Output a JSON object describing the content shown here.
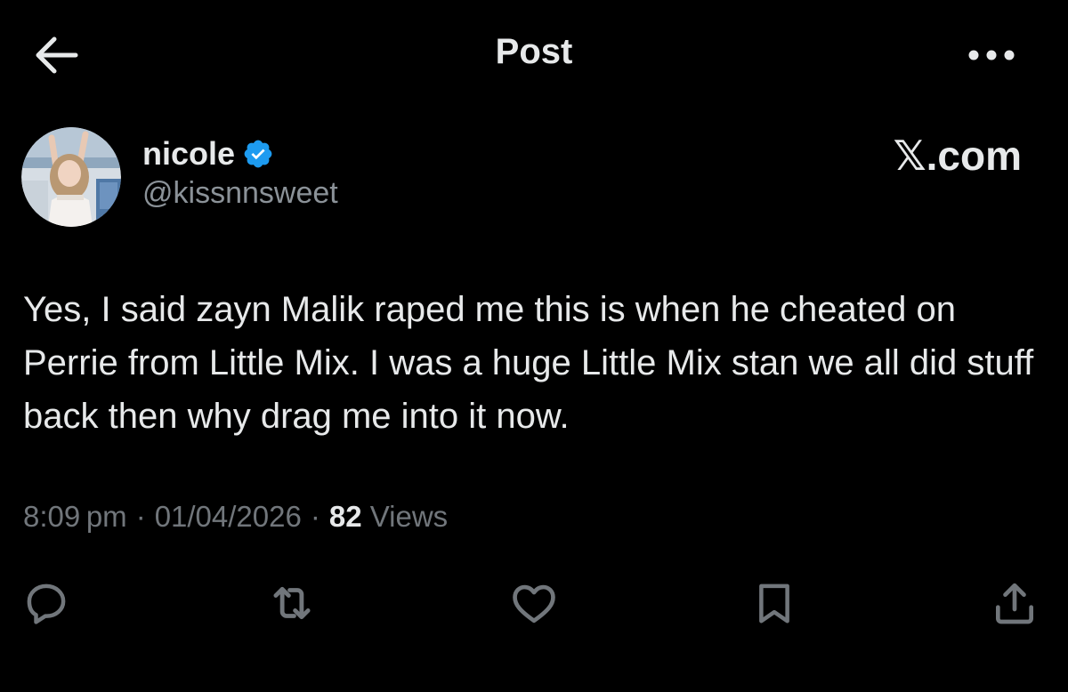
{
  "header": {
    "title": "Post",
    "back_icon": "arrow-left-icon",
    "more_icon": "more-horizontal-icon"
  },
  "author": {
    "display_name": "nicole",
    "verified_icon": "verified-badge-icon",
    "verified_color": "#1d9bf0",
    "handle": "@kissnnsweet"
  },
  "watermark": {
    "text": "𝕏.com"
  },
  "post": {
    "text": "Yes, I said zayn  Malik raped me this is when he cheated on Perrie from Little Mix. I was a huge Little Mix stan we all did stuff back then why drag me into it now."
  },
  "meta": {
    "time": "8:09 pm",
    "separator1": "·",
    "date": "01/04/2026",
    "separator2": "·",
    "views_count": "82",
    "views_label": "Views"
  },
  "actions": [
    {
      "icon": "reply-icon"
    },
    {
      "icon": "repost-icon"
    },
    {
      "icon": "like-icon"
    },
    {
      "icon": "bookmark-icon"
    },
    {
      "icon": "share-icon"
    }
  ],
  "colors": {
    "background": "#000000",
    "primary_text": "#e7e9ea",
    "secondary_text": "#71767b",
    "icon": "#71767b",
    "accent": "#1d9bf0"
  }
}
